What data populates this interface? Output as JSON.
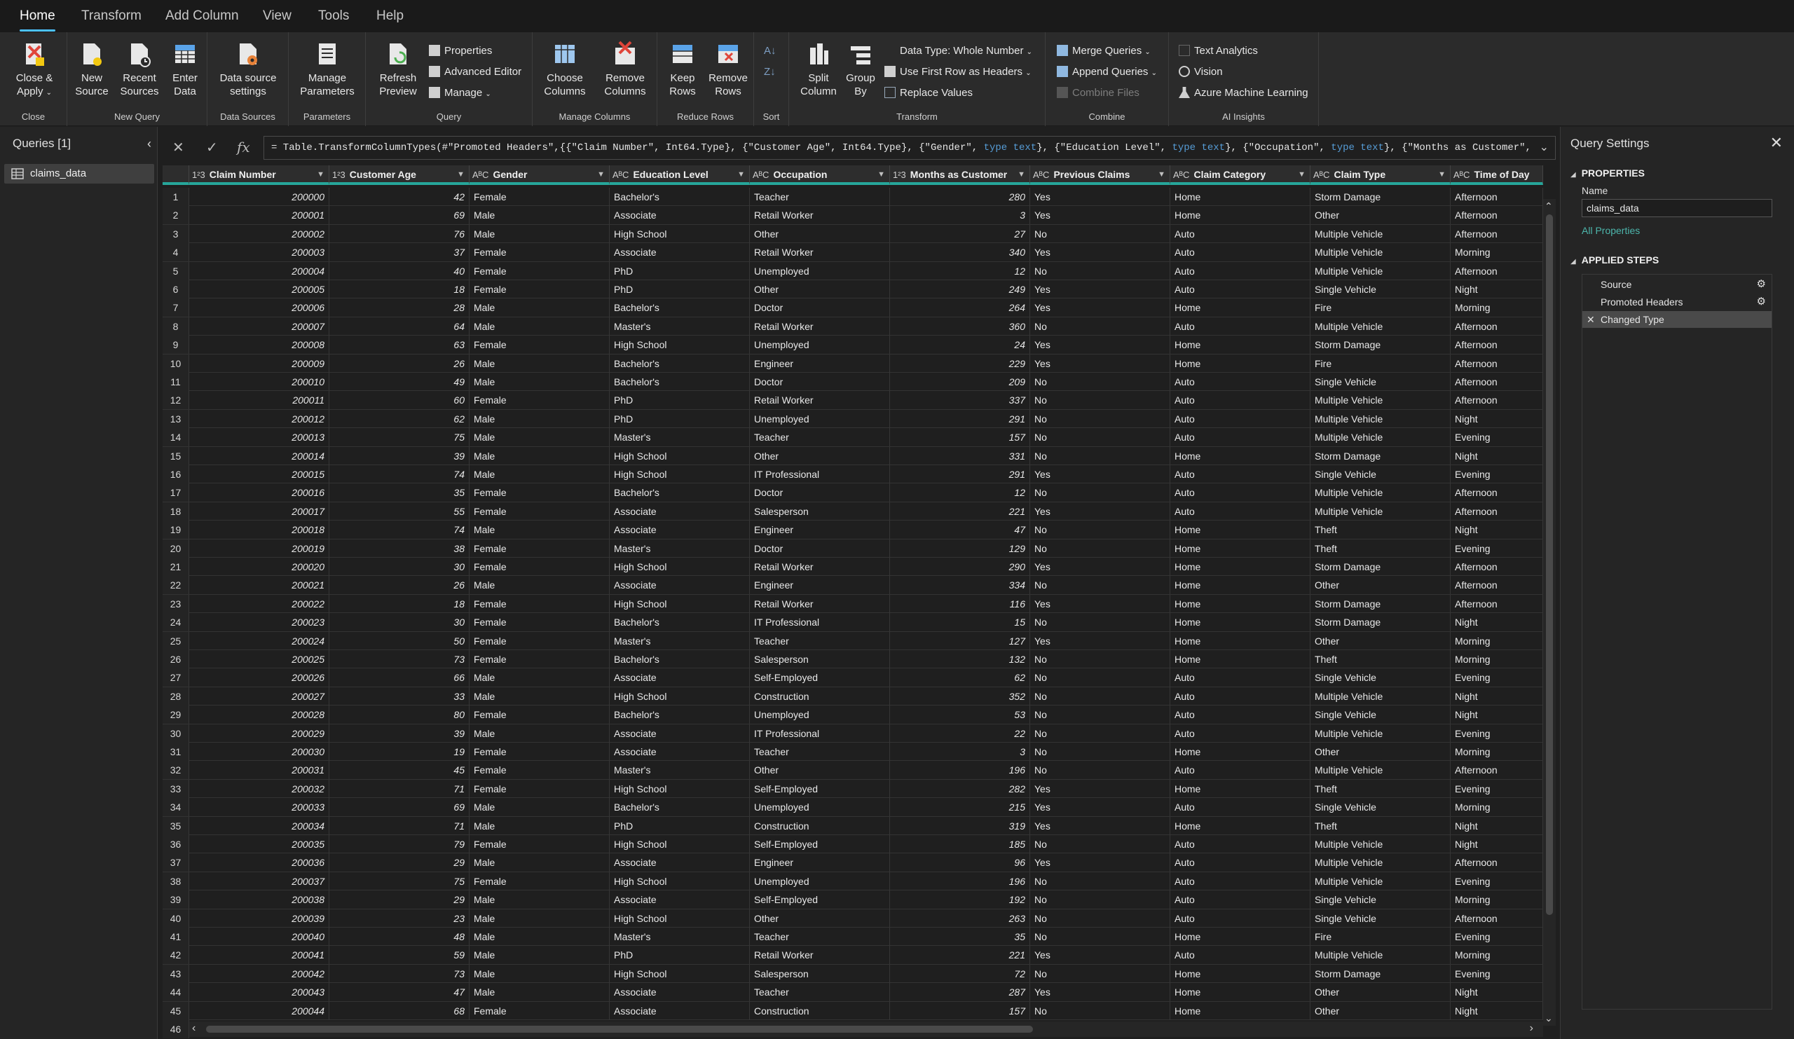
{
  "menu": {
    "tabs": [
      "Home",
      "Transform",
      "Add Column",
      "View",
      "Tools",
      "Help"
    ],
    "active": "Home"
  },
  "ribbon": {
    "close_apply": "Close & Apply",
    "new_source": "New Source",
    "recent_sources": "Recent Sources",
    "enter_data": "Enter Data",
    "data_source_settings": "Data source settings",
    "manage_parameters": "Manage Parameters",
    "refresh_preview": "Refresh Preview",
    "properties": "Properties",
    "advanced_editor": "Advanced Editor",
    "manage": "Manage",
    "choose_columns": "Choose Columns",
    "remove_columns": "Remove Columns",
    "keep_rows": "Keep Rows",
    "remove_rows": "Remove Rows",
    "split_column": "Split Column",
    "group_by": "Group By",
    "data_type": "Data Type: Whole Number",
    "use_first_row": "Use First Row as Headers",
    "replace_values": "Replace Values",
    "merge_queries": "Merge Queries",
    "append_queries": "Append Queries",
    "combine_files": "Combine Files",
    "text_analytics": "Text Analytics",
    "vision": "Vision",
    "azure_ml": "Azure Machine Learning",
    "groups": {
      "close": "Close",
      "new_query": "New Query",
      "data_sources": "Data Sources",
      "parameters": "Parameters",
      "query": "Query",
      "manage_columns": "Manage Columns",
      "reduce_rows": "Reduce Rows",
      "sort": "Sort",
      "transform": "Transform",
      "combine": "Combine",
      "ai_insights": "AI Insights"
    }
  },
  "queries": {
    "title": "Queries [1]",
    "items": [
      "claims_data"
    ]
  },
  "formula": {
    "prefix": "= Table.TransformColumnTypes(#\"Promoted Headers\",{{\"Claim Number\", Int64.Type}, {\"Customer Age\", Int64.Type}, {\"Gender\", ",
    "t1": "type text",
    "mid1": "}, {\"Education Level\", ",
    "t2": "type text",
    "mid2": "}, {\"Occupation\", ",
    "t3": "type text",
    "mid3": "}, {\"Months as Customer\","
  },
  "columns": [
    {
      "name": "Claim Number",
      "type": "1²3"
    },
    {
      "name": "Customer Age",
      "type": "1²3"
    },
    {
      "name": "Gender",
      "type": "AᴮC"
    },
    {
      "name": "Education Level",
      "type": "AᴮC"
    },
    {
      "name": "Occupation",
      "type": "AᴮC"
    },
    {
      "name": "Months as Customer",
      "type": "1²3"
    },
    {
      "name": "Previous Claims",
      "type": "AᴮC"
    },
    {
      "name": "Claim Category",
      "type": "AᴮC"
    },
    {
      "name": "Claim Type",
      "type": "AᴮC"
    },
    {
      "name": "Time of Day",
      "type": "AᴮC"
    }
  ],
  "rows": [
    [
      "200000",
      "42",
      "Female",
      "Bachelor's",
      "Teacher",
      "280",
      "Yes",
      "Home",
      "Storm Damage",
      "Afternoon"
    ],
    [
      "200001",
      "69",
      "Male",
      "Associate",
      "Retail Worker",
      "3",
      "Yes",
      "Home",
      "Other",
      "Afternoon"
    ],
    [
      "200002",
      "76",
      "Male",
      "High School",
      "Other",
      "27",
      "No",
      "Auto",
      "Multiple Vehicle",
      "Afternoon"
    ],
    [
      "200003",
      "37",
      "Female",
      "Associate",
      "Retail Worker",
      "340",
      "Yes",
      "Auto",
      "Multiple Vehicle",
      "Morning"
    ],
    [
      "200004",
      "40",
      "Female",
      "PhD",
      "Unemployed",
      "12",
      "No",
      "Auto",
      "Multiple Vehicle",
      "Afternoon"
    ],
    [
      "200005",
      "18",
      "Female",
      "PhD",
      "Other",
      "249",
      "Yes",
      "Auto",
      "Single Vehicle",
      "Night"
    ],
    [
      "200006",
      "28",
      "Male",
      "Bachelor's",
      "Doctor",
      "264",
      "Yes",
      "Home",
      "Fire",
      "Morning"
    ],
    [
      "200007",
      "64",
      "Male",
      "Master's",
      "Retail Worker",
      "360",
      "No",
      "Auto",
      "Multiple Vehicle",
      "Afternoon"
    ],
    [
      "200008",
      "63",
      "Female",
      "High School",
      "Unemployed",
      "24",
      "Yes",
      "Home",
      "Storm Damage",
      "Afternoon"
    ],
    [
      "200009",
      "26",
      "Male",
      "Bachelor's",
      "Engineer",
      "229",
      "Yes",
      "Home",
      "Fire",
      "Afternoon"
    ],
    [
      "200010",
      "49",
      "Male",
      "Bachelor's",
      "Doctor",
      "209",
      "No",
      "Auto",
      "Single Vehicle",
      "Afternoon"
    ],
    [
      "200011",
      "60",
      "Female",
      "PhD",
      "Retail Worker",
      "337",
      "No",
      "Auto",
      "Multiple Vehicle",
      "Afternoon"
    ],
    [
      "200012",
      "62",
      "Male",
      "PhD",
      "Unemployed",
      "291",
      "No",
      "Auto",
      "Multiple Vehicle",
      "Night"
    ],
    [
      "200013",
      "75",
      "Male",
      "Master's",
      "Teacher",
      "157",
      "No",
      "Auto",
      "Multiple Vehicle",
      "Evening"
    ],
    [
      "200014",
      "39",
      "Male",
      "High School",
      "Other",
      "331",
      "No",
      "Home",
      "Storm Damage",
      "Night"
    ],
    [
      "200015",
      "74",
      "Male",
      "High School",
      "IT Professional",
      "291",
      "Yes",
      "Auto",
      "Single Vehicle",
      "Evening"
    ],
    [
      "200016",
      "35",
      "Female",
      "Bachelor's",
      "Doctor",
      "12",
      "No",
      "Auto",
      "Multiple Vehicle",
      "Afternoon"
    ],
    [
      "200017",
      "55",
      "Female",
      "Associate",
      "Salesperson",
      "221",
      "Yes",
      "Auto",
      "Multiple Vehicle",
      "Afternoon"
    ],
    [
      "200018",
      "74",
      "Male",
      "Associate",
      "Engineer",
      "47",
      "No",
      "Home",
      "Theft",
      "Night"
    ],
    [
      "200019",
      "38",
      "Female",
      "Master's",
      "Doctor",
      "129",
      "No",
      "Home",
      "Theft",
      "Evening"
    ],
    [
      "200020",
      "30",
      "Female",
      "High School",
      "Retail Worker",
      "290",
      "Yes",
      "Home",
      "Storm Damage",
      "Afternoon"
    ],
    [
      "200021",
      "26",
      "Male",
      "Associate",
      "Engineer",
      "334",
      "No",
      "Home",
      "Other",
      "Afternoon"
    ],
    [
      "200022",
      "18",
      "Female",
      "High School",
      "Retail Worker",
      "116",
      "Yes",
      "Home",
      "Storm Damage",
      "Afternoon"
    ],
    [
      "200023",
      "30",
      "Female",
      "Bachelor's",
      "IT Professional",
      "15",
      "No",
      "Home",
      "Storm Damage",
      "Night"
    ],
    [
      "200024",
      "50",
      "Female",
      "Master's",
      "Teacher",
      "127",
      "Yes",
      "Home",
      "Other",
      "Morning"
    ],
    [
      "200025",
      "73",
      "Female",
      "Bachelor's",
      "Salesperson",
      "132",
      "No",
      "Home",
      "Theft",
      "Morning"
    ],
    [
      "200026",
      "66",
      "Male",
      "Associate",
      "Self-Employed",
      "62",
      "No",
      "Auto",
      "Single Vehicle",
      "Evening"
    ],
    [
      "200027",
      "33",
      "Male",
      "High School",
      "Construction",
      "352",
      "No",
      "Auto",
      "Multiple Vehicle",
      "Night"
    ],
    [
      "200028",
      "80",
      "Female",
      "Bachelor's",
      "Unemployed",
      "53",
      "No",
      "Auto",
      "Single Vehicle",
      "Night"
    ],
    [
      "200029",
      "39",
      "Male",
      "Associate",
      "IT Professional",
      "22",
      "No",
      "Auto",
      "Multiple Vehicle",
      "Evening"
    ],
    [
      "200030",
      "19",
      "Female",
      "Associate",
      "Teacher",
      "3",
      "No",
      "Home",
      "Other",
      "Morning"
    ],
    [
      "200031",
      "45",
      "Female",
      "Master's",
      "Other",
      "196",
      "No",
      "Auto",
      "Multiple Vehicle",
      "Afternoon"
    ],
    [
      "200032",
      "71",
      "Female",
      "High School",
      "Self-Employed",
      "282",
      "Yes",
      "Home",
      "Theft",
      "Evening"
    ],
    [
      "200033",
      "69",
      "Male",
      "Bachelor's",
      "Unemployed",
      "215",
      "Yes",
      "Auto",
      "Single Vehicle",
      "Morning"
    ],
    [
      "200034",
      "71",
      "Male",
      "PhD",
      "Construction",
      "319",
      "Yes",
      "Home",
      "Theft",
      "Night"
    ],
    [
      "200035",
      "79",
      "Female",
      "High School",
      "Self-Employed",
      "185",
      "No",
      "Auto",
      "Multiple Vehicle",
      "Night"
    ],
    [
      "200036",
      "29",
      "Male",
      "Associate",
      "Engineer",
      "96",
      "Yes",
      "Auto",
      "Multiple Vehicle",
      "Afternoon"
    ],
    [
      "200037",
      "75",
      "Female",
      "High School",
      "Unemployed",
      "196",
      "No",
      "Auto",
      "Multiple Vehicle",
      "Evening"
    ],
    [
      "200038",
      "29",
      "Male",
      "Associate",
      "Self-Employed",
      "192",
      "No",
      "Auto",
      "Single Vehicle",
      "Morning"
    ],
    [
      "200039",
      "23",
      "Male",
      "High School",
      "Other",
      "263",
      "No",
      "Auto",
      "Single Vehicle",
      "Afternoon"
    ],
    [
      "200040",
      "48",
      "Male",
      "Master's",
      "Teacher",
      "35",
      "No",
      "Home",
      "Fire",
      "Evening"
    ],
    [
      "200041",
      "59",
      "Male",
      "PhD",
      "Retail Worker",
      "221",
      "Yes",
      "Auto",
      "Multiple Vehicle",
      "Morning"
    ],
    [
      "200042",
      "73",
      "Male",
      "High School",
      "Salesperson",
      "72",
      "No",
      "Home",
      "Storm Damage",
      "Evening"
    ],
    [
      "200043",
      "47",
      "Male",
      "Associate",
      "Teacher",
      "287",
      "Yes",
      "Home",
      "Other",
      "Night"
    ],
    [
      "200044",
      "68",
      "Female",
      "Associate",
      "Construction",
      "157",
      "No",
      "Home",
      "Other",
      "Night"
    ]
  ],
  "last_row_number": "46",
  "settings": {
    "title": "Query Settings",
    "properties_header": "PROPERTIES",
    "name_label": "Name",
    "name_value": "claims_data",
    "all_properties": "All Properties",
    "applied_steps_header": "APPLIED STEPS",
    "steps": [
      "Source",
      "Promoted Headers",
      "Changed Type"
    ]
  },
  "colors": {
    "accent": "#26a69a",
    "tab_underline": "#4cc2ff",
    "link": "#4db6ac"
  }
}
